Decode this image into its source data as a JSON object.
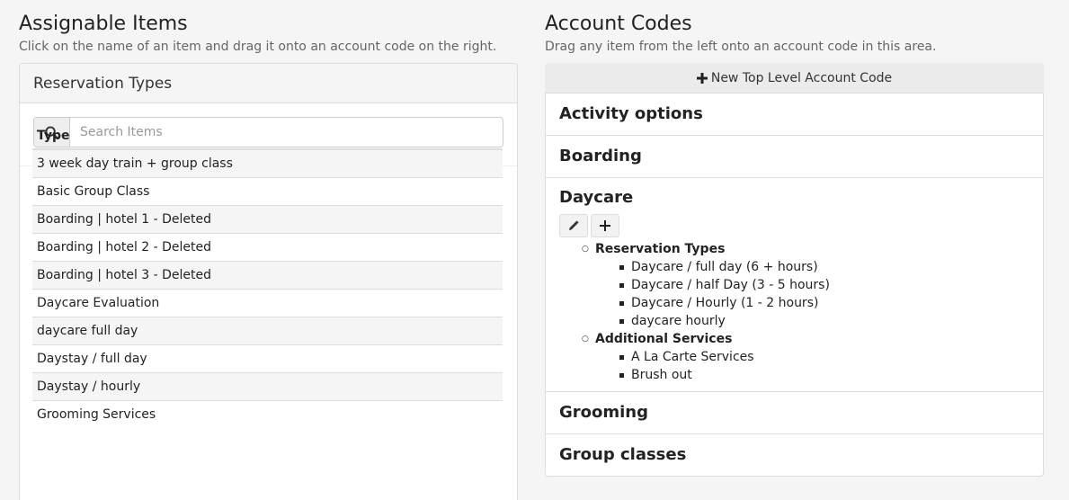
{
  "left": {
    "title": "Assignable Items",
    "subtitle": "Click on the name of an item and drag it onto an account code on the right.",
    "panel_heading": "Reservation Types",
    "search_placeholder": "Search Items",
    "table_header": "Type",
    "rows": [
      "3 week day train + group class",
      "Basic Group Class",
      "Boarding | hotel 1 - Deleted",
      "Boarding | hotel 2 - Deleted",
      "Boarding | hotel 3 - Deleted",
      "Daycare Evaluation",
      "daycare full day",
      "Daystay / full day",
      "Daystay / hourly",
      "Grooming Services"
    ]
  },
  "right": {
    "title": "Account Codes",
    "subtitle": "Drag any item from the left onto an account code in this area.",
    "new_button": "New Top Level Account Code",
    "codes": {
      "activity": "Activity options",
      "boarding": "Boarding",
      "daycare": "Daycare",
      "grooming": "Grooming",
      "group": "Group classes"
    },
    "daycare_tree": {
      "reservation_types_label": "Reservation Types",
      "reservation_types": [
        "Daycare / full day (6 + hours)",
        "Daycare / half Day (3 - 5 hours)",
        "Daycare / Hourly (1 - 2 hours)",
        "daycare hourly"
      ],
      "additional_services_label": "Additional Services",
      "additional_services": [
        "A La Carte Services",
        "Brush out"
      ]
    }
  }
}
